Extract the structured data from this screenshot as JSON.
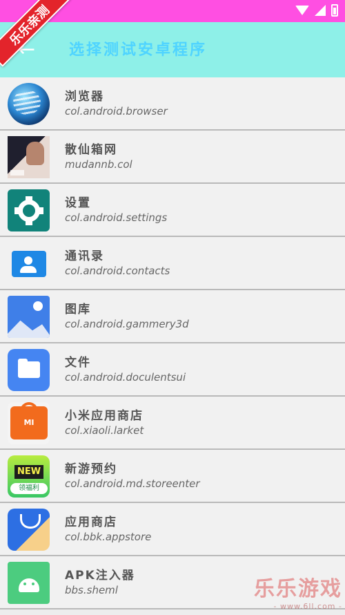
{
  "statusbar": {
    "icons": [
      "wifi-icon",
      "signal-icon",
      "battery-icon"
    ]
  },
  "ribbon": {
    "label": "乐乐亲测"
  },
  "appbar": {
    "back_glyph": "←",
    "title": "选择测试安卓程序"
  },
  "apps": [
    {
      "name": "浏览器",
      "package": "col.android.browser",
      "icon": "browser-icon"
    },
    {
      "name": "散仙箱网",
      "package": "mudannb.col",
      "icon": "photo-icon"
    },
    {
      "name": "设置",
      "package": "col.android.settings",
      "icon": "settings-icon"
    },
    {
      "name": "通讯录",
      "package": "col.android.contacts",
      "icon": "contacts-icon"
    },
    {
      "name": "图库",
      "package": "col.android.gammery3d",
      "icon": "gallery-icon"
    },
    {
      "name": "文件",
      "package": "col.android.doculentsui",
      "icon": "files-icon"
    },
    {
      "name": "小米应用商店",
      "package": "col.xiaoli.larket",
      "icon": "mi-store-icon"
    },
    {
      "name": "新游预约",
      "package": "col.android.md.storeenter",
      "icon": "new-game-icon"
    },
    {
      "name": "应用商店",
      "package": "col.bbk.appstore",
      "icon": "app-store-icon"
    },
    {
      "name": "APK注入器",
      "package": "bbs.sheml",
      "icon": "android-icon"
    }
  ],
  "icon_text": {
    "mi": "MI",
    "new_tag": "NEW",
    "new_sub": "领福利"
  },
  "watermark": {
    "title": "乐乐游戏",
    "url": "- www.6ll.com -"
  },
  "colors": {
    "statusbar": "#ff4fe2",
    "appbar": "#8ef0e8",
    "title": "#4fd4ff"
  }
}
